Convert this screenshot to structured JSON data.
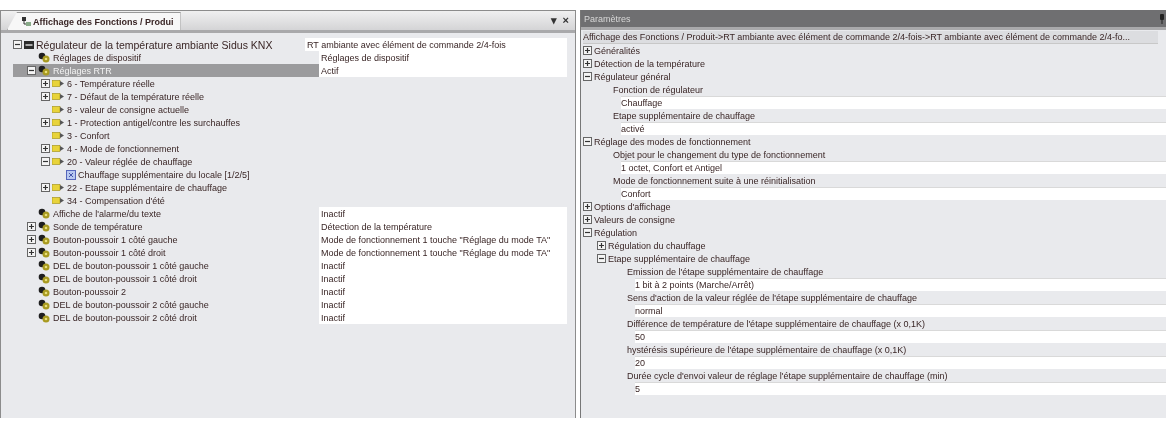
{
  "left_panel": {
    "tab": "Affichage des Fonctions / Produi",
    "menu_glyph": "▾",
    "close_glyph": "×",
    "tree": [
      {
        "label": "Régulateur de la température ambiante Sidus KNX",
        "value": "RT ambiante avec élément de commande 2/4-fois",
        "kind": "device",
        "expanded": true,
        "selected": false,
        "children": [
          {
            "label": "Réglages de dispositif",
            "value": "Réglages de dispositif",
            "kind": "module",
            "selected": false
          },
          {
            "label": "Réglages RTR",
            "value": "Actif",
            "kind": "module",
            "expanded": true,
            "selected": true,
            "children": [
              {
                "label": "6 - Température réelle",
                "kind": "object",
                "expanded": false,
                "selected": false
              },
              {
                "label": "7 - Défaut de la température réelle",
                "kind": "object",
                "expanded": false,
                "selected": false
              },
              {
                "label": "8 - valeur de consigne actuelle",
                "kind": "object",
                "selected": false
              },
              {
                "label": "1 - Protection antigel/contre les surchauffes",
                "kind": "object",
                "expanded": false,
                "selected": false
              },
              {
                "label": "3 - Confort",
                "kind": "object",
                "selected": false
              },
              {
                "label": "4 - Mode de fonctionnement",
                "kind": "object",
                "expanded": false,
                "selected": false
              },
              {
                "label": "20 - Valeur réglée de chauffage",
                "kind": "object",
                "expanded": true,
                "selected": false,
                "children": [
                  {
                    "label": "Chauffage supplémentaire du locale [1/2/5]",
                    "kind": "address",
                    "selected": false
                  }
                ]
              },
              {
                "label": "22 - Etape supplémentaire de chauffage",
                "kind": "object",
                "expanded": false,
                "selected": false
              },
              {
                "label": "34 - Compensation d'été",
                "kind": "object",
                "selected": false
              }
            ]
          },
          {
            "label": "Affiche de l'alarme/du texte",
            "value": "Inactif",
            "kind": "module",
            "selected": false
          },
          {
            "label": "Sonde de température",
            "value": "Détection de la température",
            "kind": "module",
            "expanded": false,
            "selected": false
          },
          {
            "label": "Bouton-poussoir 1 côté gauche",
            "value": "Mode de fonctionnement 1 touche \"Réglage du mode TA\"",
            "kind": "module",
            "expanded": false,
            "selected": false
          },
          {
            "label": "Bouton-poussoir 1 côté droit",
            "value": "Mode de fonctionnement 1 touche \"Réglage du mode TA\"",
            "kind": "module",
            "expanded": false,
            "selected": false
          },
          {
            "label": "DEL de bouton-poussoir 1 côté gauche",
            "value": "Inactif",
            "kind": "module",
            "selected": false
          },
          {
            "label": "DEL de bouton-poussoir 1 côté droit",
            "value": "Inactif",
            "kind": "module",
            "selected": false
          },
          {
            "label": "Bouton-poussoir 2",
            "value": "Inactif",
            "kind": "module",
            "selected": false
          },
          {
            "label": "DEL de bouton-poussoir 2 côté gauche",
            "value": "Inactif",
            "kind": "module",
            "selected": false
          },
          {
            "label": "DEL de bouton-poussoir 2 côté droit",
            "value": "Inactif",
            "kind": "module",
            "selected": false
          }
        ]
      }
    ]
  },
  "right_panel": {
    "title": "Paramètres",
    "breadcrumb": "Affichage des Fonctions / Produit->RT ambiante avec élément de commande 2/4-fois->RT ambiante avec élément de commande 2/4-fo...",
    "items": [
      {
        "kind": "group",
        "label": "Généralités",
        "expanded": false
      },
      {
        "kind": "group",
        "label": "Détection de la température",
        "expanded": false
      },
      {
        "kind": "group",
        "label": "Régulateur général",
        "expanded": true,
        "children": [
          {
            "kind": "param",
            "label": "Fonction de régulateur",
            "value": "Chauffage"
          },
          {
            "kind": "param",
            "label": "Etape supplémentaire de chauffage",
            "value": "activé"
          }
        ]
      },
      {
        "kind": "group",
        "label": "Réglage des modes de fonctionnement",
        "expanded": true,
        "children": [
          {
            "kind": "param",
            "label": "Objet pour le changement du type de fonctionnement",
            "value": "1 octet, Confort et Antigel"
          },
          {
            "kind": "param",
            "label": "Mode de fonctionnement suite à une réinitialisation",
            "value": "Confort"
          }
        ]
      },
      {
        "kind": "group",
        "label": "Options d'affichage",
        "expanded": false
      },
      {
        "kind": "group",
        "label": "Valeurs de consigne",
        "expanded": false
      },
      {
        "kind": "group",
        "label": "Régulation",
        "expanded": true,
        "children": [
          {
            "kind": "group",
            "label": "Régulation du chauffage",
            "expanded": false
          },
          {
            "kind": "group",
            "label": "Etape supplémentaire de chauffage",
            "expanded": true,
            "children": [
              {
                "kind": "param",
                "label": "Emission de l'étape supplémentaire de chauffage",
                "value": "1 bit à 2 points (Marche/Arrêt)"
              },
              {
                "kind": "param",
                "label": "Sens d'action de la valeur réglée de l'étape supplémentaire de chauffage",
                "value": "normal"
              },
              {
                "kind": "param",
                "label": "Différence de température de l'étape supplémentaire de chauffage (x 0,1K)",
                "value": "50"
              },
              {
                "kind": "param",
                "label": "hystérésis supérieure de l'étape supplémentaire de chauffage (x 0,1K)",
                "value": "20"
              },
              {
                "kind": "param",
                "label": "Durée cycle d'envoi valeur de réglage l'étape supplémentaire de chauffage (min)",
                "value": "5"
              }
            ]
          }
        ]
      }
    ]
  }
}
